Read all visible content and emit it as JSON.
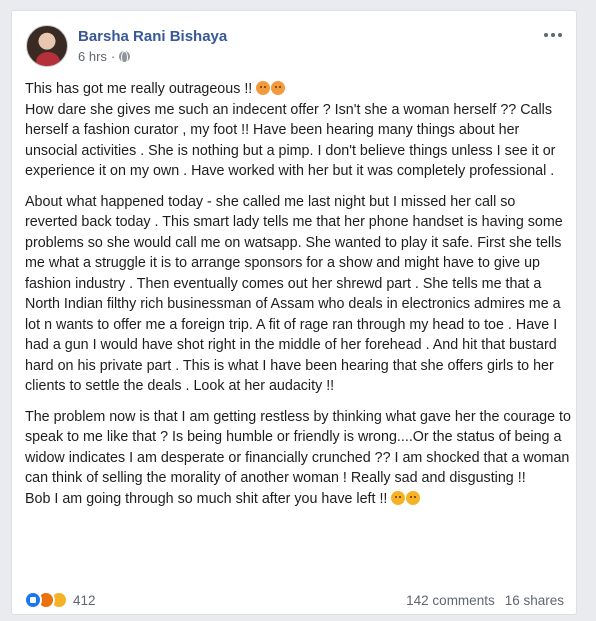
{
  "post": {
    "author": "Barsha Rani Bishaya",
    "time": "6 hrs",
    "separator": "·",
    "paragraphs": [
      {
        "text": "This has got me really outrageous !! ",
        "emoji_after_first_line": [
          "angry-emoji",
          "angry-emoji"
        ],
        "rest": "How dare she gives me such an indecent offer ? Isn't she a woman herself ?? Calls herself a fashion curator , my foot !! Have been hearing many things about her unsocial activities . She is nothing but a pimp. I don't believe things unless I see it or experience it on my own . Have worked with her but it was completely professional ."
      },
      {
        "text": "About what happened today - she called me last night but I missed her call so reverted back today . This smart lady tells me that her phone handset is having some problems so she would call me on watsapp. She wanted to play it safe. First she tells me what a struggle it is to arrange sponsors for a show and might have to give up fashion industry . Then eventually comes out her shrewd part . She tells me that a North Indian filthy rich businessman of Assam who deals in electronics admires me a lot n wants to offer me a foreign trip. A fit of rage ran through my head to toe . Have I had a gun I would have shot right in the middle of her forehead . And hit that bustard hard on his private part . This is what I have been hearing that she offers girls to her clients to settle the deals . Look at her audacity !!"
      },
      {
        "text": "The problem now is that I am getting restless by thinking what gave her the courage to speak to me like that ? Is being humble or friendly is wrong....Or the status of being a widow indicates I am desperate or financially crunched ?? I am shocked that a woman can think of selling the morality of another woman ! Really sad and disgusting !!",
        "last_line": "Bob I am going through so much shit after you have left !! ",
        "emoji_end": [
          "sad-emoji",
          "sad-emoji"
        ]
      }
    ]
  },
  "footer": {
    "reaction_count": "412",
    "comments": "142 comments",
    "shares": "16 shares"
  },
  "colors": {
    "author": "#385898",
    "meta": "#616770",
    "like": "#1877f2",
    "angry": "#e9710f",
    "sad": "#f7b125"
  }
}
